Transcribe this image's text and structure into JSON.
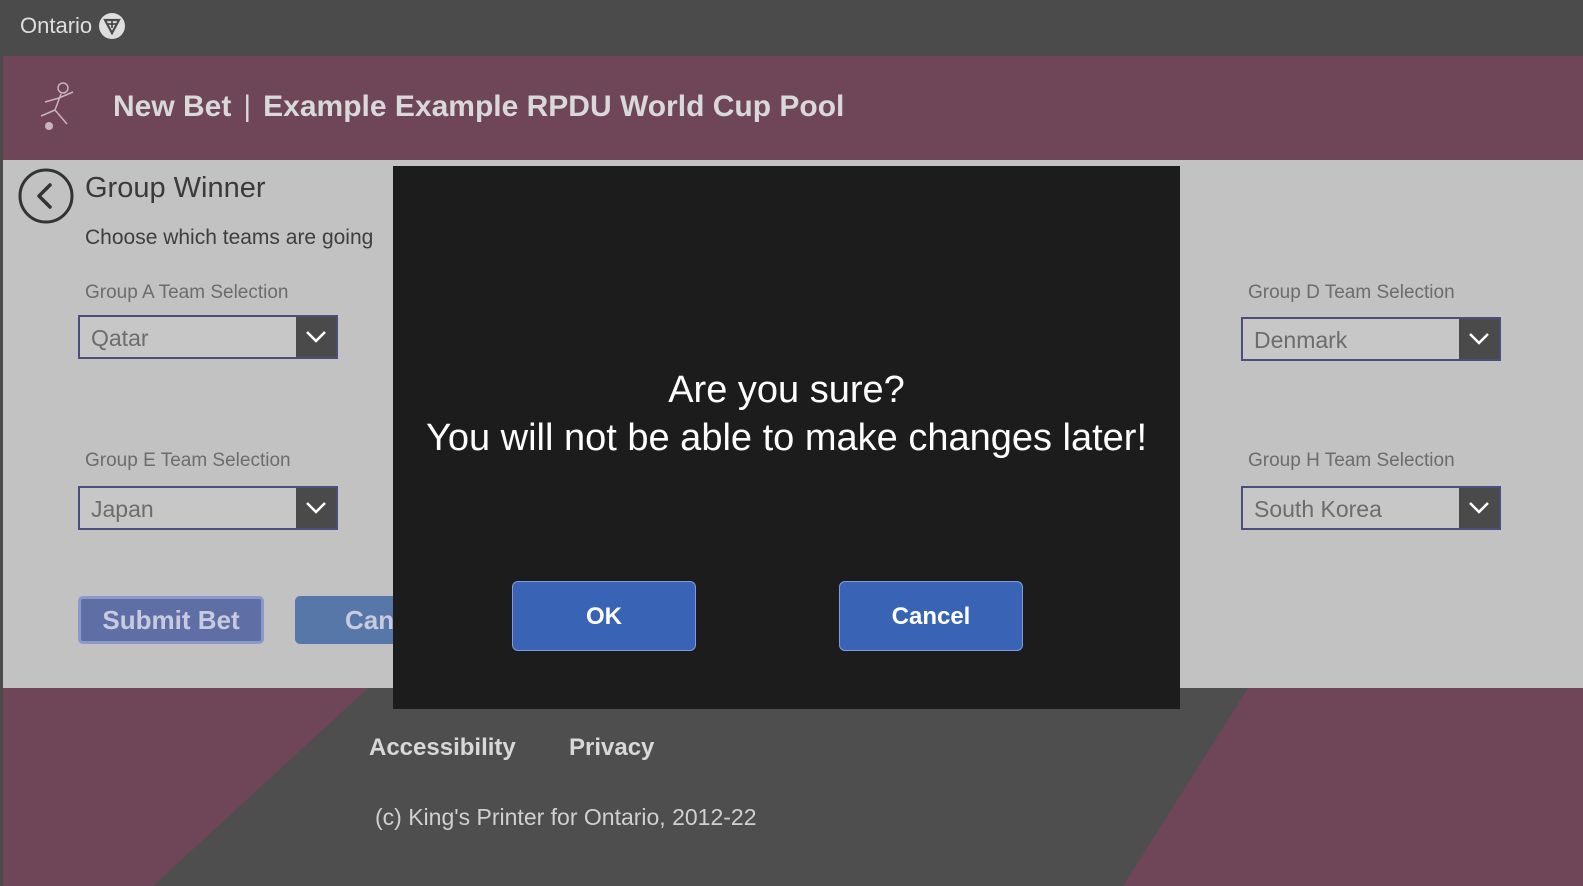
{
  "top_bar": {
    "brand": "Ontario"
  },
  "header": {
    "title": "New Bet",
    "separator": "|",
    "subtitle": "Example Example RPDU World Cup Pool"
  },
  "main": {
    "heading": "Group Winner",
    "description": "Choose which teams are going",
    "selections": [
      {
        "label": "Group A Team Selection",
        "value": "Qatar"
      },
      {
        "label": "Group D Team Selection",
        "value": "Denmark"
      },
      {
        "label": "Group E Team Selection",
        "value": "Japan"
      },
      {
        "label": "Group H Team Selection",
        "value": "South Korea"
      }
    ],
    "submit_label": "Submit Bet",
    "cancel_label": "Can"
  },
  "dialog": {
    "line1": "Are you sure?",
    "line2": "You will not be able to make changes later!",
    "ok_label": "OK",
    "cancel_label": "Cancel"
  },
  "footer": {
    "accessibility": "Accessibility",
    "privacy": "Privacy",
    "copyright": "(c) King's Printer for Ontario, 2012-22"
  },
  "colors": {
    "header_bg": "#6f4558",
    "dialog_bg": "#1c1c1c",
    "primary_button": "#3963b5",
    "content_bg": "#c2c2c2"
  },
  "icons": [
    "ontario-trillium-icon",
    "soccer-player-icon",
    "back-arrow-icon",
    "chevron-down-icon"
  ]
}
